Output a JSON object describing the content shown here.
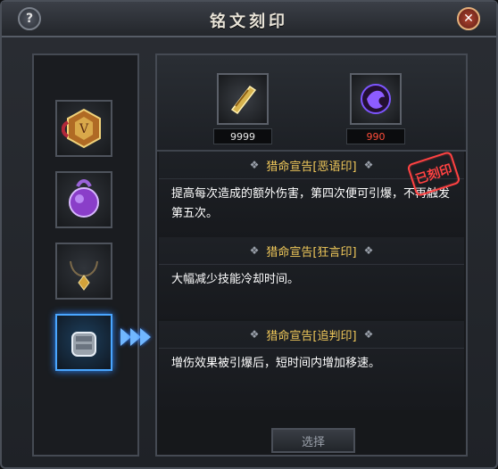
{
  "window": {
    "title": "铭文刻印",
    "help_label": "?",
    "close_label": "✕"
  },
  "left_slots": [
    {
      "icon": "hexagon-amulet-icon",
      "selected": false
    },
    {
      "icon": "purple-orb-icon",
      "selected": false
    },
    {
      "icon": "necklace-icon",
      "selected": false
    },
    {
      "icon": "armor-icon",
      "selected": true
    }
  ],
  "materials": [
    {
      "icon": "scroll-icon",
      "count": "9999",
      "color": "#e6e6e6"
    },
    {
      "icon": "purple-gem-icon",
      "count": "990",
      "color": "#ff4d3a"
    }
  ],
  "sections": [
    {
      "title": "猎命宣告[恶语印]",
      "body": "提高每次造成的额外伤害，第四次便可引爆，不再触发第五次。"
    },
    {
      "title": "猎命宣告[狂言印]",
      "body": "大幅减少技能冷却时间。"
    },
    {
      "title": "猎命宣告[追判印]",
      "body": "增伤效果被引爆后，短时间内增加移速。"
    }
  ],
  "stamp": {
    "text": "已刻印"
  },
  "actions": {
    "select_label": "选择"
  }
}
